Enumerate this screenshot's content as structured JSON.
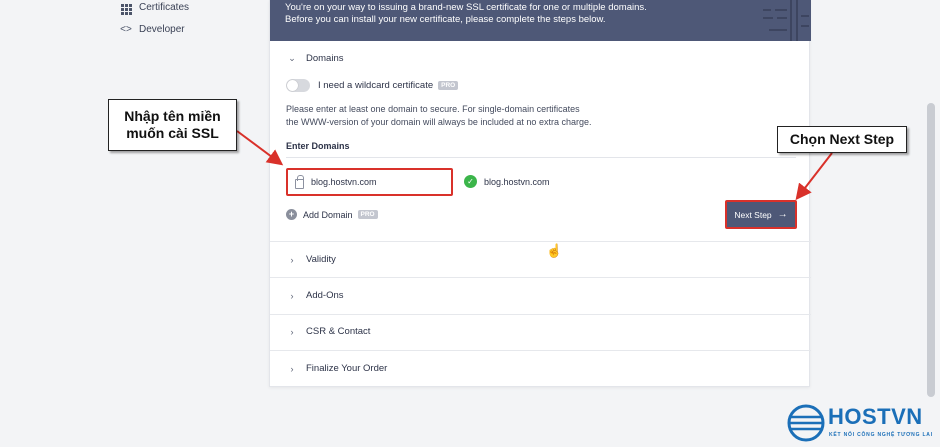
{
  "sidebar": {
    "items": [
      {
        "label": "Certificates",
        "icon": "grid-icon"
      },
      {
        "label": "Developer",
        "icon": "code-icon"
      }
    ]
  },
  "banner": {
    "line1": "You're on your way to issuing a brand-new SSL certificate for one or multiple domains.",
    "line2": "Before you can install your new certificate, please complete the steps below."
  },
  "domains": {
    "title": "Domains",
    "wildcard_label": "I need a wildcard certificate",
    "wildcard_enabled": false,
    "pro_badge": "PRO",
    "info_line1": "Please enter at least one domain to secure. For single-domain certificates",
    "info_line2": "the WWW-version of your domain will always be included at no extra charge.",
    "enter_label": "Enter Domains",
    "input_value": "blog.hostvn.com",
    "validated_domain": "blog.hostvn.com",
    "add_domain_label": "Add Domain",
    "add_pro_badge": "PRO",
    "next_label": "Next Step"
  },
  "sections": [
    {
      "title": "Validity"
    },
    {
      "title": "Add-Ons"
    },
    {
      "title": "CSR & Contact"
    },
    {
      "title": "Finalize Your Order"
    }
  ],
  "annotations": {
    "left_line1": "Nhập tên miền",
    "left_line2": "muốn cài SSL",
    "right": "Chọn Next Step",
    "arrow_color": "#d9312a"
  },
  "logo": {
    "name": "HOSTVN",
    "tagline": "KẾT NỐI CÔNG NGHỆ TƯƠNG LAI",
    "color": "#1b6fb8"
  },
  "colors": {
    "banner_bg": "#4e5877",
    "highlight": "#d9312a",
    "success": "#3bb54a"
  }
}
